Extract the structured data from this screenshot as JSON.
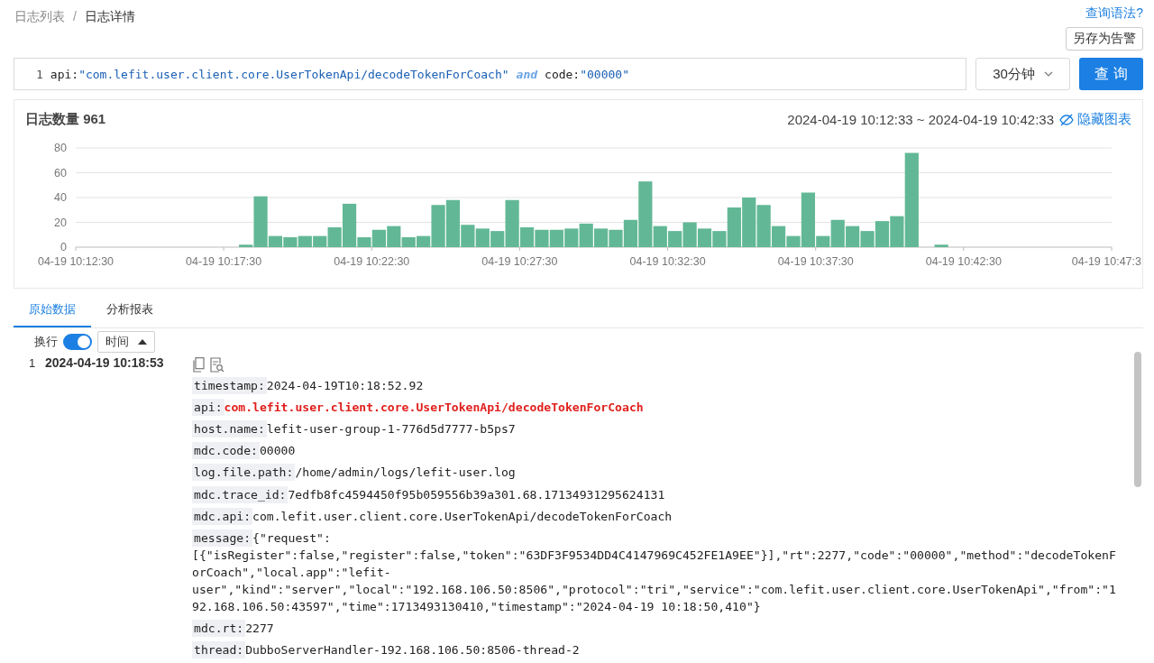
{
  "breadcrumb": [
    {
      "label": "日志列表"
    },
    {
      "label": "日志详情"
    }
  ],
  "breadcrumb_separator": "/",
  "syntax_link": "查询语法?",
  "save_alert_button": "另存为告警",
  "query": {
    "line_number": "1",
    "tokens": [
      {
        "kind": "key",
        "text": "api:"
      },
      {
        "kind": "string",
        "text": "\"com.lefit.user.client.core.UserTokenApi/decodeTokenForCoach\""
      },
      {
        "kind": "operator",
        "text": "and"
      },
      {
        "kind": "key",
        "text": "code:"
      },
      {
        "kind": "string",
        "text": "\"00000\""
      }
    ]
  },
  "time_range_select": {
    "value": "30分钟"
  },
  "search_button": "查 询",
  "chart_panel": {
    "title": "日志数量 961",
    "range": "2024-04-19 10:12:33 ~ 2024-04-19 10:42:33",
    "hide_link": "隐藏图表",
    "chart_data": {
      "type": "bar",
      "categories": [
        "04-19 10:12:30",
        null,
        null,
        null,
        null,
        null,
        null,
        null,
        null,
        null,
        "04-19 10:17:30",
        null,
        null,
        null,
        null,
        null,
        null,
        null,
        null,
        null,
        "04-19 10:22:30",
        null,
        null,
        null,
        null,
        null,
        null,
        null,
        null,
        null,
        "04-19 10:27:30",
        null,
        null,
        null,
        null,
        null,
        null,
        null,
        null,
        null,
        "04-19 10:32:30",
        null,
        null,
        null,
        null,
        null,
        null,
        null,
        null,
        null,
        "04-19 10:37:30",
        null,
        null,
        null,
        null,
        null,
        null,
        null,
        null,
        null,
        "04-19 10:42:30",
        null,
        null,
        null,
        null,
        null,
        null,
        null,
        null,
        null,
        "04-19 10:47:3"
      ],
      "grid": true,
      "series": [
        {
          "color": "#62b896",
          "values": [
            null,
            null,
            null,
            null,
            null,
            null,
            null,
            null,
            null,
            null,
            null,
            2,
            41,
            9,
            8,
            9,
            9,
            16,
            35,
            8,
            14,
            17,
            8,
            9,
            34,
            38,
            18,
            15,
            13,
            38,
            16,
            14,
            14,
            15,
            19,
            15,
            14,
            22,
            53,
            17,
            13,
            20,
            15,
            13,
            32,
            40,
            34,
            17,
            9,
            44,
            9,
            22,
            17,
            13,
            21,
            25,
            76,
            null,
            2,
            null,
            null,
            null,
            null,
            null,
            null,
            null,
            null,
            null,
            null,
            null,
            null
          ]
        }
      ],
      "ylim": [
        0,
        80
      ],
      "yticks": [
        0,
        20,
        40,
        60,
        80
      ]
    }
  },
  "tabs": [
    {
      "label": "原始数据",
      "selected": true
    },
    {
      "label": "分析报表",
      "selected": false
    }
  ],
  "toolbar": {
    "wrap": {
      "label": "换行",
      "on": true
    },
    "sort": {
      "label": "时间"
    }
  },
  "logs": [
    {
      "index": "1",
      "time": "2024-04-19 10:18:53",
      "fields": [
        {
          "key": "timestamp:",
          "value": "2024-04-19T10:18:52.92",
          "highlight": false
        },
        {
          "key": "api:",
          "value": "com.lefit.user.client.core.UserTokenApi/decodeTokenForCoach",
          "highlight": true
        },
        {
          "key": "host.name:",
          "value": "lefit-user-group-1-776d5d7777-b5ps7",
          "highlight": false
        },
        {
          "key": "mdc.code:",
          "value": "00000",
          "highlight": false
        },
        {
          "key": "log.file.path:",
          "value": "/home/admin/logs/lefit-user.log",
          "highlight": false
        },
        {
          "key": "mdc.trace_id:",
          "value": "7edfb8fc4594450f95b059556b39a301.68.17134931295624131",
          "highlight": false
        },
        {
          "key": "mdc.api:",
          "value": "com.lefit.user.client.core.UserTokenApi/decodeTokenForCoach",
          "highlight": false
        },
        {
          "key": "message:",
          "value": "{\"request\":[{\"isRegister\":false,\"register\":false,\"token\":\"63DF3F9534DD4C4147969C452FE1A9EE\"}],\"rt\":2277,\"code\":\"00000\",\"method\":\"decodeTokenForCoach\",\"local.app\":\"lefit-user\",\"kind\":\"server\",\"local\":\"192.168.106.50:8506\",\"protocol\":\"tri\",\"service\":\"com.lefit.user.client.core.UserTokenApi\",\"from\":\"192.168.106.50:43597\",\"time\":1713493130410,\"timestamp\":\"2024-04-19 10:18:50,410\"}",
          "highlight": false
        },
        {
          "key": "mdc.rt:",
          "value": "2277",
          "highlight": false
        },
        {
          "key": "thread:",
          "value": "DubboServerHandler-192.168.106.50:8506-thread-2",
          "highlight": false
        }
      ]
    }
  ]
}
